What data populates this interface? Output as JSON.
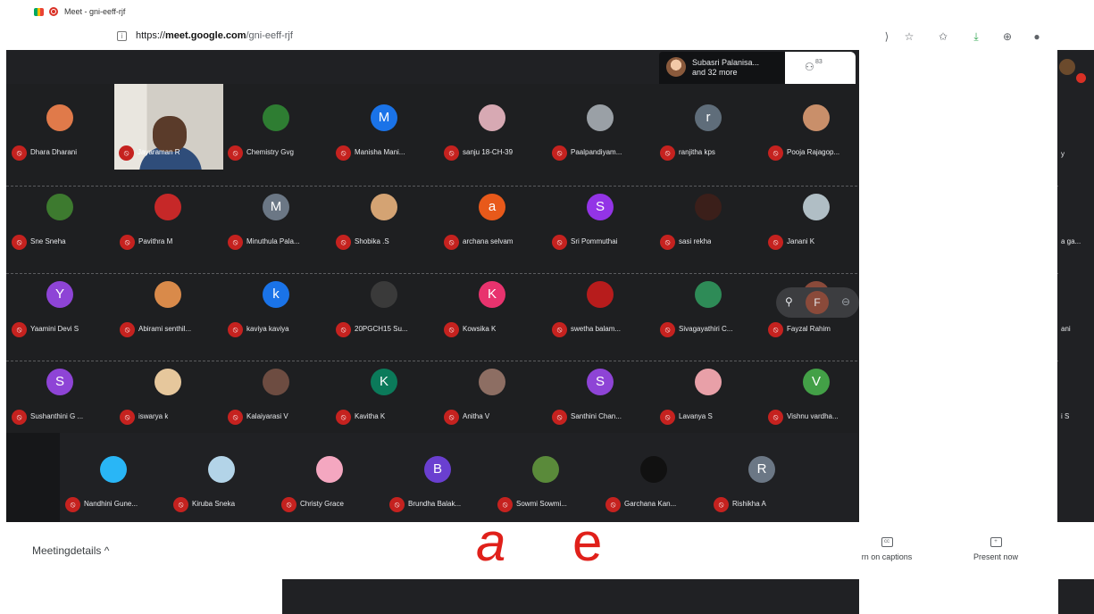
{
  "browser": {
    "tab_title": "Meet - gni-eeff-rjf",
    "url_prefix": "https://",
    "url_domain": "meet.google.com",
    "url_path": "/gni-eeff-rjf"
  },
  "topbar": {
    "speaker_line1": "Subasri Palanisa...",
    "speaker_line2": "and 32 more",
    "people_count": "83"
  },
  "participants": [
    {
      "name": "Dhara Dharani",
      "initial": "",
      "color": "#e07a4a"
    },
    {
      "name": "Jayaraman R",
      "initial": "",
      "color": "#5a3b2a"
    },
    {
      "name": "Chemistry Gvg",
      "initial": "",
      "color": "#2e7d32"
    },
    {
      "name": "Manisha Mani...",
      "initial": "M",
      "color": "#1a73e8"
    },
    {
      "name": "sanju 18-CH-39",
      "initial": "",
      "color": "#d7a9b3"
    },
    {
      "name": "Paalpandiyam...",
      "initial": "",
      "color": "#9aa0a6"
    },
    {
      "name": "ranjitha kps",
      "initial": "r",
      "color": "#5f6d7a"
    },
    {
      "name": "Pooja Rajagop...",
      "initial": "",
      "color": "#c98f6a"
    },
    {
      "name": "Sne Sneha",
      "initial": "",
      "color": "#3d7a2f"
    },
    {
      "name": "Pavithra M",
      "initial": "",
      "color": "#c62828"
    },
    {
      "name": "Minuthula Pala...",
      "initial": "M",
      "color": "#6b7785"
    },
    {
      "name": "Shobika .S",
      "initial": "",
      "color": "#d4a373"
    },
    {
      "name": "archana selvam",
      "initial": "a",
      "color": "#e8591a"
    },
    {
      "name": "Sri Pommuthai",
      "initial": "S",
      "color": "#9334e6"
    },
    {
      "name": "sasi rekha",
      "initial": "",
      "color": "#3b1f1a"
    },
    {
      "name": "Janani K",
      "initial": "",
      "color": "#b0bec5"
    },
    {
      "name": "Yaamini Devi S",
      "initial": "Y",
      "color": "#8e44d6"
    },
    {
      "name": "Abirami senthil...",
      "initial": "",
      "color": "#d98a4a"
    },
    {
      "name": "kaviya kaviya",
      "initial": "k",
      "color": "#1a73e8"
    },
    {
      "name": "20PGCH15 Su...",
      "initial": "",
      "color": "#3a3a3a"
    },
    {
      "name": "Kowsika K",
      "initial": "K",
      "color": "#e8336e"
    },
    {
      "name": "swetha balam...",
      "initial": "",
      "color": "#b71c1c"
    },
    {
      "name": "Sivagayathiri C...",
      "initial": "",
      "color": "#2e8b57"
    },
    {
      "name": "Fayzal Rahim",
      "initial": "",
      "color": "#8a4a3a"
    },
    {
      "name": "Sushanthini G ...",
      "initial": "S",
      "color": "#8e44d6"
    },
    {
      "name": "iswarya k",
      "initial": "",
      "color": "#e6c79c"
    },
    {
      "name": "Kalaiyarasi V",
      "initial": "",
      "color": "#6d4c41"
    },
    {
      "name": "Kavitha K",
      "initial": "K",
      "color": "#0b7a5a"
    },
    {
      "name": "Anitha V",
      "initial": "",
      "color": "#8d6e63"
    },
    {
      "name": "Santhini Chan...",
      "initial": "S",
      "color": "#8e44d6"
    },
    {
      "name": "Lavanya S",
      "initial": "",
      "color": "#e8a0a8"
    },
    {
      "name": "Vishnu vardha...",
      "initial": "V",
      "color": "#43a047"
    }
  ],
  "bottom_row": [
    {
      "name": "Nandhini Gune...",
      "initial": "",
      "color": "#29b6f6"
    },
    {
      "name": "Kiruba Sneka",
      "initial": "",
      "color": "#b3d4e8"
    },
    {
      "name": "Christy Grace",
      "initial": "",
      "color": "#f4a7c0"
    },
    {
      "name": "Brundha Balak...",
      "initial": "B",
      "color": "#6a3fd0"
    },
    {
      "name": "Sowmi Sowmi...",
      "initial": "",
      "color": "#5a8a3a"
    },
    {
      "name": "Garchana Kan...",
      "initial": "",
      "color": "#111111"
    },
    {
      "name": "Rishikha A",
      "initial": "R",
      "color": "#6b7785"
    }
  ],
  "right_cut_names": [
    "y",
    "a ga...",
    "ani",
    "i S"
  ],
  "footer": {
    "meeting_details": "Meetingdetails ^",
    "captions": "rn on captions",
    "present_now": "Present now",
    "overlay_a": "a",
    "overlay_e": "e"
  }
}
